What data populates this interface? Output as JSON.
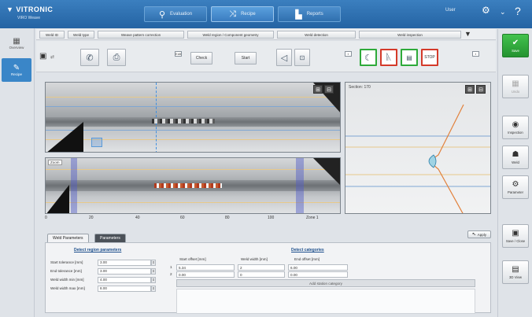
{
  "app": {
    "title": "VITRONIC",
    "subtitle": "VIRO Weave"
  },
  "top_tabs": [
    {
      "label": "Evaluation",
      "icon": "search-icon"
    },
    {
      "label": "Recipe",
      "icon": "shuffle-icon"
    },
    {
      "label": "Reports",
      "icon": "factory-icon"
    }
  ],
  "topbar": {
    "user": "User",
    "colors": {
      "bar": "#2f6fae",
      "accent": "#3a86c8"
    }
  },
  "left_nav": [
    {
      "label": "Overview",
      "icon": "grid-icon"
    },
    {
      "label": "Recipe",
      "icon": "tool-icon"
    }
  ],
  "toolbar1": [
    "Weld ID",
    "Weld type",
    "Weave pattern correction",
    "Weld region / Component geometry",
    "Weld detection",
    "Weld inspection"
  ],
  "toolbar2": {
    "check_label": "Check",
    "start_label": "Start",
    "small_label": "Edit",
    "status_buttons": [
      "Seam",
      "Track",
      "Log",
      "STOP"
    ]
  },
  "profile": {
    "title": "Section: 170"
  },
  "scan_bottom_label": "Zoom",
  "axis_ticks": [
    "0",
    "20",
    "40",
    "60",
    "80",
    "100",
    "Zone 1"
  ],
  "bottom_tabs": [
    "Weld Parameters",
    "Parameters"
  ],
  "bottom_right_button": "Apply",
  "region_params": {
    "title": "Detect region parameters",
    "rows": [
      {
        "label": "Start tolerance [mm]",
        "value": "3.00"
      },
      {
        "label": "End tolerance [mm]",
        "value": "3.00"
      },
      {
        "label": "Weld width min [mm]",
        "value": "4.00"
      },
      {
        "label": "Weld width max [mm]",
        "value": "8.00"
      }
    ]
  },
  "categories": {
    "title": "Detect categories",
    "headers": [
      "Start offset [mm]",
      "Weld width [mm]",
      "End offset [mm]"
    ],
    "rows": [
      {
        "index": "1",
        "cells": [
          "5.34",
          "2",
          "6.00"
        ]
      },
      {
        "index": "2",
        "cells": [
          "0.00",
          "0",
          "0.00"
        ]
      }
    ],
    "add_label": "Add station category"
  },
  "right_rail": [
    {
      "label": "Save",
      "icon": "check-icon",
      "style": "green"
    },
    {
      "label": "Undo",
      "icon": "undo-icon",
      "style": "disabled"
    },
    {
      "label": "Inspection",
      "icon": "eye-icon",
      "style": "normal"
    },
    {
      "label": "Weld",
      "icon": "robot-icon",
      "style": "normal"
    },
    {
      "label": "Parameter",
      "icon": "gear-icon",
      "style": "normal"
    },
    {
      "label": "Save / Close",
      "icon": "save-icon",
      "style": "normal"
    },
    {
      "label": "3D View",
      "icon": "monitor-icon",
      "style": "normal"
    }
  ]
}
